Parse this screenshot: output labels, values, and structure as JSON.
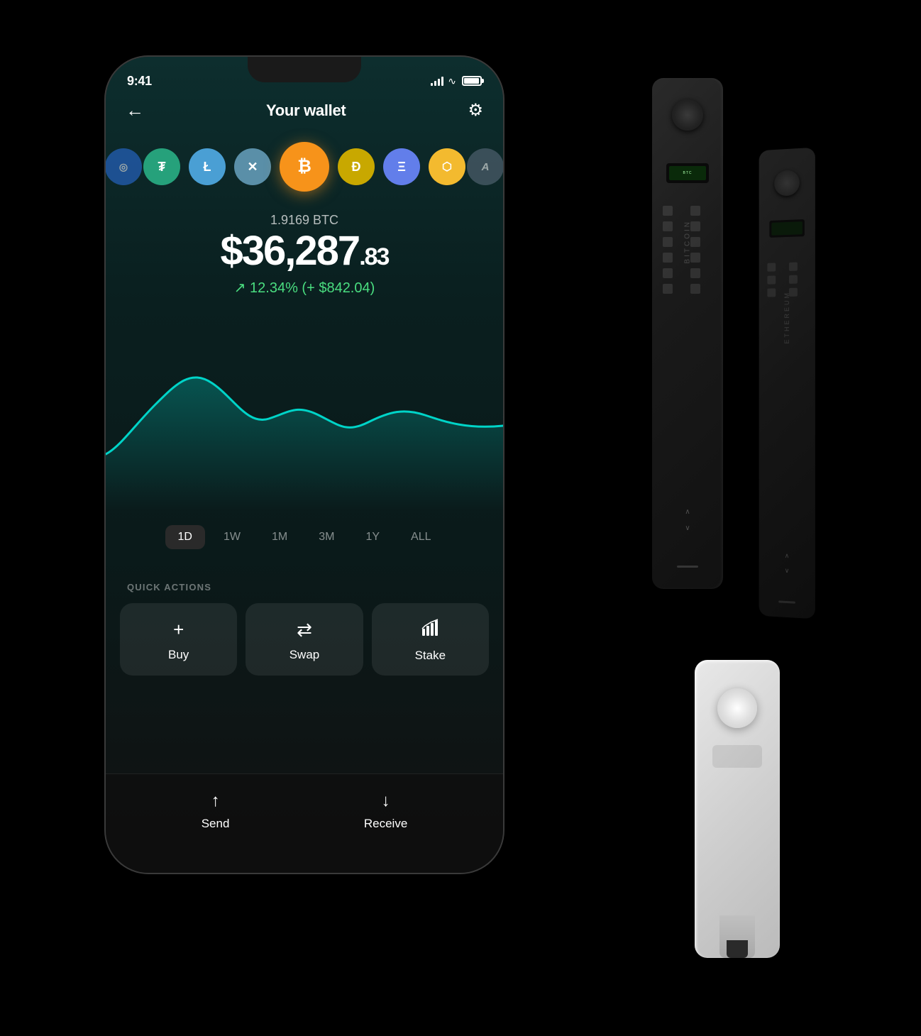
{
  "app": {
    "title": "Your wallet"
  },
  "status_bar": {
    "time": "9:41",
    "signal_label": "signal",
    "wifi_label": "wifi",
    "battery_label": "battery"
  },
  "header": {
    "back_label": "←",
    "title": "Your wallet",
    "settings_label": "⚙"
  },
  "coins": [
    {
      "id": "unknown",
      "symbol": "",
      "color": "#2a6dd9",
      "partial": true
    },
    {
      "id": "usdt",
      "symbol": "₮",
      "color": "#26a17b"
    },
    {
      "id": "ltc",
      "symbol": "Ł",
      "color": "#4a9fd4"
    },
    {
      "id": "xrp",
      "symbol": "✕",
      "color": "#5a8fa8"
    },
    {
      "id": "btc",
      "symbol": "₿",
      "color": "#f7931a",
      "active": true
    },
    {
      "id": "doge",
      "symbol": "Ð",
      "color": "#c8a800"
    },
    {
      "id": "eth",
      "symbol": "Ξ",
      "color": "#627eea"
    },
    {
      "id": "bnb",
      "symbol": "⬡",
      "color": "#f3ba2f"
    },
    {
      "id": "algo",
      "symbol": "A",
      "color": "#5a6a7a",
      "partial": true
    }
  ],
  "price": {
    "btc_amount": "1.9169 BTC",
    "usd_whole": "$36,287",
    "usd_cents": ".83",
    "change_text": "↗ 12.34% (+ $842.04)",
    "change_color": "#4ade80"
  },
  "chart": {
    "label": "price chart"
  },
  "time_periods": [
    {
      "label": "1D",
      "active": true
    },
    {
      "label": "1W",
      "active": false
    },
    {
      "label": "1M",
      "active": false
    },
    {
      "label": "3M",
      "active": false
    },
    {
      "label": "1Y",
      "active": false
    },
    {
      "label": "ALL",
      "active": false
    }
  ],
  "quick_actions": {
    "label": "QUICK ACTIONS",
    "buttons": [
      {
        "id": "buy",
        "icon": "+",
        "label": "Buy"
      },
      {
        "id": "swap",
        "icon": "⇄",
        "label": "Swap"
      },
      {
        "id": "stake",
        "icon": "↗",
        "label": "Stake"
      }
    ]
  },
  "bottom_nav": {
    "buttons": [
      {
        "id": "send",
        "icon": "↑",
        "label": "Send"
      },
      {
        "id": "receive",
        "icon": "↓",
        "label": "Receive"
      }
    ]
  },
  "ledger_devices": {
    "device1_label": "Bitcoin",
    "device2_label": "Ethereum"
  }
}
